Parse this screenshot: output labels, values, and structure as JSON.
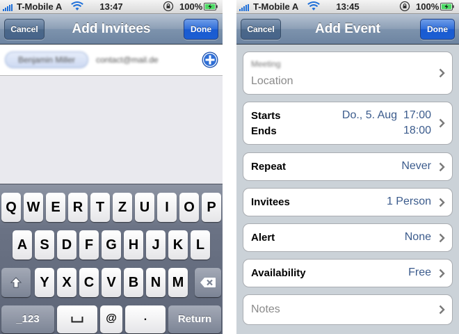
{
  "left_screen": {
    "status": {
      "carrier": "T-Mobile A",
      "time": "13:47",
      "battery": "100%"
    },
    "nav": {
      "title": "Add Invitees",
      "cancel": "Cancel",
      "done": "Done"
    },
    "invitee_field": {
      "contact_bubble": "Benjamin Miller",
      "typed_address": "contact@mail.de"
    },
    "keyboard": {
      "row1": [
        "Q",
        "W",
        "E",
        "R",
        "T",
        "Z",
        "U",
        "I",
        "O",
        "P"
      ],
      "row2": [
        "A",
        "S",
        "D",
        "F",
        "G",
        "H",
        "J",
        "K",
        "L"
      ],
      "row3": [
        "Y",
        "X",
        "C",
        "V",
        "B",
        "N",
        "M"
      ],
      "numbers": "_123",
      "at": "@",
      "dot": ".",
      "return": "Return"
    }
  },
  "right_screen": {
    "status": {
      "carrier": "T-Mobile A",
      "time": "13:45",
      "battery": "100%"
    },
    "nav": {
      "title": "Add Event",
      "cancel": "Cancel",
      "done": "Done"
    },
    "title_location": {
      "title_value": "Meeting",
      "location_placeholder": "Location"
    },
    "dates": {
      "starts_label": "Starts",
      "ends_label": "Ends",
      "start_value": "Do., 5. Aug  17:00",
      "end_value": "18:00"
    },
    "repeat": {
      "label": "Repeat",
      "value": "Never"
    },
    "invitees": {
      "label": "Invitees",
      "value": "1 Person"
    },
    "alert": {
      "label": "Alert",
      "value": "None"
    },
    "availability": {
      "label": "Availability",
      "value": "Free"
    },
    "notes": {
      "placeholder": "Notes"
    }
  },
  "colors": {
    "nav_bar": "#7d93ad",
    "done_button": "#1a5bd1",
    "cell_value": "#3b5b8c",
    "add_icon": "#2f6fd6",
    "signal_bars": "#1e6fd9",
    "battery_fill": "#4cd964"
  },
  "icons": [
    "signal-icon",
    "wifi-icon",
    "orientation-lock-icon",
    "battery-icon",
    "add-contact-icon",
    "shift-icon",
    "backspace-icon",
    "space-icon",
    "chevron-right-icon"
  ]
}
